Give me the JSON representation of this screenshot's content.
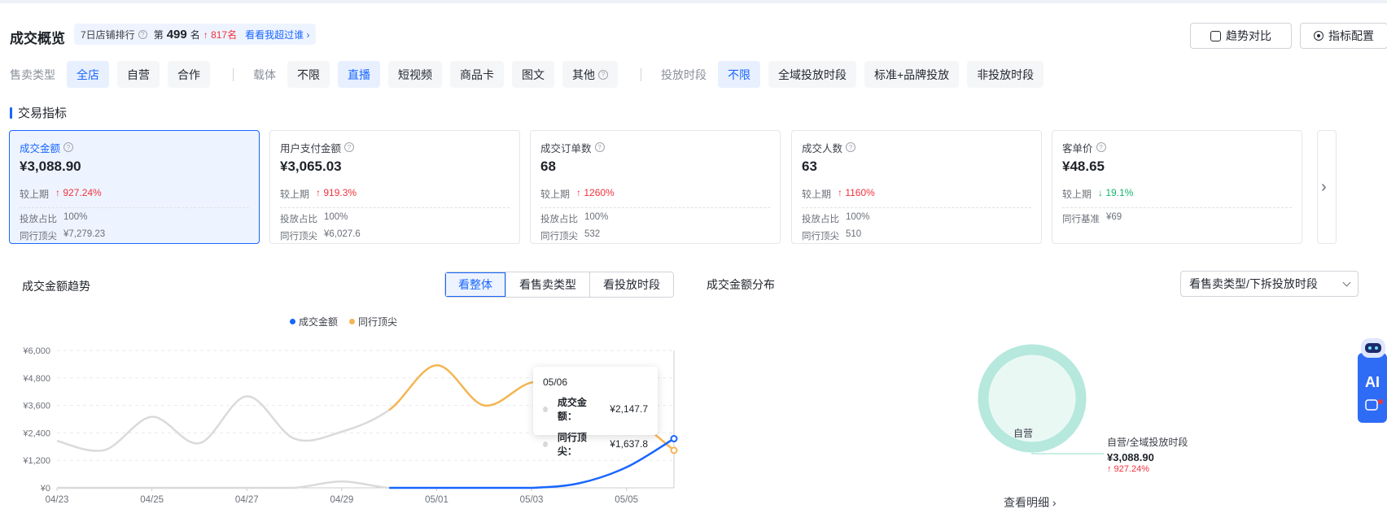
{
  "header": {
    "title": "成交概览",
    "rank_label": "7日店铺排行",
    "rank_prefix": "第",
    "rank_number": "499",
    "rank_suffix": "名",
    "rank_change": "↑ 817名",
    "rank_link": "看看我超过谁 ›",
    "trend_compare_btn": "趋势对比",
    "metric_config_btn": "指标配置"
  },
  "filters": {
    "sell_type_label": "售卖类型",
    "sell_types": [
      "全店",
      "自营",
      "合作"
    ],
    "carrier_label": "载体",
    "carriers": [
      "不限",
      "直播",
      "短视频",
      "商品卡",
      "图文",
      "其他"
    ],
    "period_label": "投放时段",
    "periods": [
      "不限",
      "全域投放时段",
      "标准+品牌投放",
      "非投放时段"
    ]
  },
  "section_title": "交易指标",
  "metrics": [
    {
      "title": "成交金额",
      "value": "¥3,088.90",
      "cmp_label": "较上期",
      "cmp": "↑ 927.24%",
      "r1_label": "投放占比",
      "r1": "100%",
      "r2_label": "同行顶尖",
      "r2": "¥7,279.23"
    },
    {
      "title": "用户支付金额",
      "value": "¥3,065.03",
      "cmp_label": "较上期",
      "cmp": "↑ 919.3%",
      "r1_label": "投放占比",
      "r1": "100%",
      "r2_label": "同行顶尖",
      "r2": "¥6,027.6"
    },
    {
      "title": "成交订单数",
      "value": "68",
      "cmp_label": "较上期",
      "cmp": "↑ 1260%",
      "r1_label": "投放占比",
      "r1": "100%",
      "r2_label": "同行顶尖",
      "r2": "532"
    },
    {
      "title": "成交人数",
      "value": "63",
      "cmp_label": "较上期",
      "cmp": "↑ 1160%",
      "r1_label": "投放占比",
      "r1": "100%",
      "r2_label": "同行顶尖",
      "r2": "510"
    },
    {
      "title": "客单价",
      "value": "¥48.65",
      "cmp_label": "较上期",
      "cmp": "↓ 19.1%",
      "r1_label": "同行基准",
      "r1": "¥69"
    }
  ],
  "trend": {
    "title": "成交金额趋势",
    "tabs": [
      "看整体",
      "看售卖类型",
      "看投放时段"
    ],
    "tooltip": {
      "date": "05/06",
      "row1_label": "成交金额：",
      "row1_value": "¥2,147.7",
      "row2_label": "同行顶尖：",
      "row2_value": "¥1,637.8"
    }
  },
  "distribution": {
    "title": "成交金额分布",
    "dropdown": "看售卖类型/下拆投放时段",
    "slice_label": "自营",
    "callout_name": "自营/全域投放时段",
    "callout_value": "¥3,088.90",
    "callout_pct": "↑ 927.24%",
    "view_detail": "查看明细 ›"
  },
  "colors": {
    "accent": "#1966ff",
    "peer": "#f5b553",
    "up": "#f0323c",
    "down": "#15b36b",
    "donut": "#b6e8dd"
  },
  "chart_data": {
    "type": "line",
    "title": "",
    "legend": [
      "成交金额",
      "同行顶尖"
    ],
    "x": [
      "04/23",
      "04/24",
      "04/25",
      "04/26",
      "04/27",
      "04/28",
      "04/29",
      "04/30",
      "05/01",
      "05/02",
      "05/03",
      "05/04",
      "05/05",
      "05/06"
    ],
    "x_ticks": [
      "04/23",
      "04/25",
      "04/27",
      "04/29",
      "05/01",
      "05/03",
      "05/05"
    ],
    "y_ticks": [
      "¥0",
      "¥1,200",
      "¥2,400",
      "¥3,600",
      "¥4,800",
      "¥6,000"
    ],
    "ylim": [
      0,
      6000
    ],
    "series": [
      {
        "name": "成交金额",
        "values": [
          0,
          0,
          0,
          0,
          0,
          0,
          280,
          0,
          0,
          0,
          0,
          200,
          900,
          2147.7
        ]
      },
      {
        "name": "同行顶尖",
        "values": [
          2050,
          1650,
          3100,
          1950,
          4000,
          2150,
          2450,
          3400,
          5350,
          3600,
          4600,
          4450,
          3300,
          1637.8
        ]
      }
    ]
  }
}
